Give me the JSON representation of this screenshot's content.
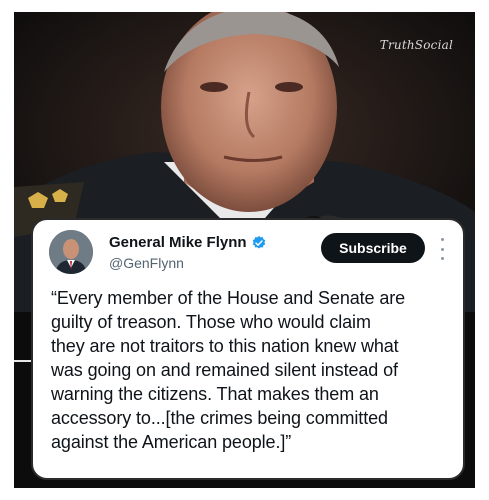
{
  "watermark": "TruthSocial",
  "post": {
    "author_name": "General Mike Flynn",
    "handle": "@GenFlynn",
    "subscribe_label": "Subscribe",
    "quote_lines": [
      "“Every member of the House and Senate are",
      "guilty of treason. Those who would claim",
      "they are not traitors to this nation knew what",
      "was going on and remained silent instead of",
      "warning the citizens.  That makes them an",
      "accessory to...[the crimes being committed",
      "against the American people.]”"
    ]
  },
  "icons": {
    "verified": "verified-badge-icon",
    "more": "more-options-icon"
  },
  "colors": {
    "verified_blue": "#1d9bf0",
    "subscribe_bg": "#0f1419",
    "handle_gray": "#536471"
  }
}
